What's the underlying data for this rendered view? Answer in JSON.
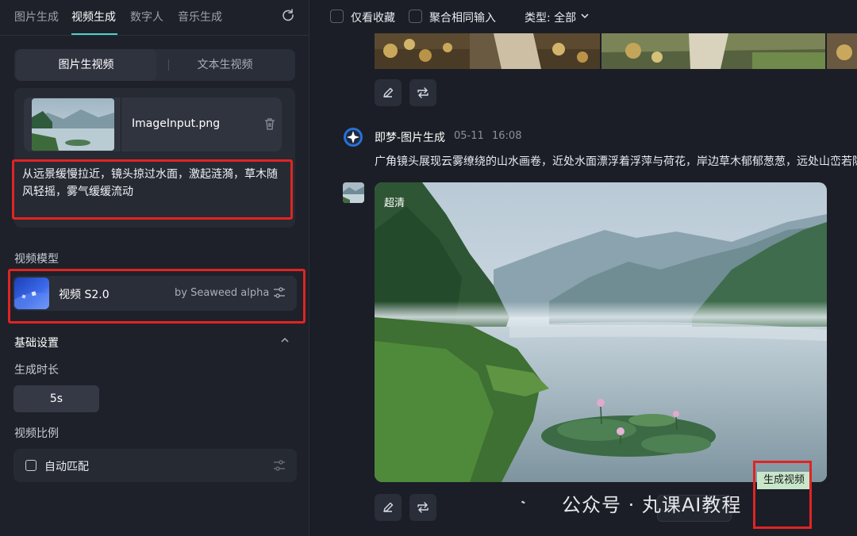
{
  "left_panel": {
    "tabs": [
      {
        "label": "图片生成",
        "active": false
      },
      {
        "label": "视频生成",
        "active": true
      },
      {
        "label": "数字人",
        "active": false
      },
      {
        "label": "音乐生成",
        "active": false
      }
    ],
    "segments": [
      {
        "label": "图片生视频",
        "active": true
      },
      {
        "label": "文本生视频",
        "active": false
      }
    ],
    "input_image": {
      "filename": "ImageInput.png"
    },
    "prompt": "从远景缓慢拉近，镜头掠过水面，激起涟漪，草木随风轻摇，雾气缓缓流动",
    "model_section_label": "视频模型",
    "model": {
      "name": "视频 S2.0",
      "by": "by Seaweed alpha"
    },
    "basic_settings_label": "基础设置",
    "duration_label": "生成时长",
    "duration_value": "5s",
    "ratio_label": "视频比例",
    "ratio_value": "自动匹配"
  },
  "right_panel": {
    "filters": {
      "favorites_only": "仅看收藏",
      "merge_same_input": "聚合相同输入",
      "type_label": "类型: 全部"
    },
    "generation": {
      "title": "即梦-图片生成",
      "date": "05-11",
      "time": "16:08",
      "prompt": "广角镜头展现云雾缭绕的山水画卷，近处水面漂浮着浮萍与荷花，岸边草木郁郁葱葱，远处山峦若隐",
      "badge": "超清",
      "generate_video_label": "生成视频"
    },
    "watermark": "公众号 · 丸课AI教程"
  },
  "colors": {
    "accent": "#4fd1c5",
    "highlight_red": "#e02424",
    "panel_bg": "#1e2129",
    "button_green": "#c8e6c9"
  }
}
